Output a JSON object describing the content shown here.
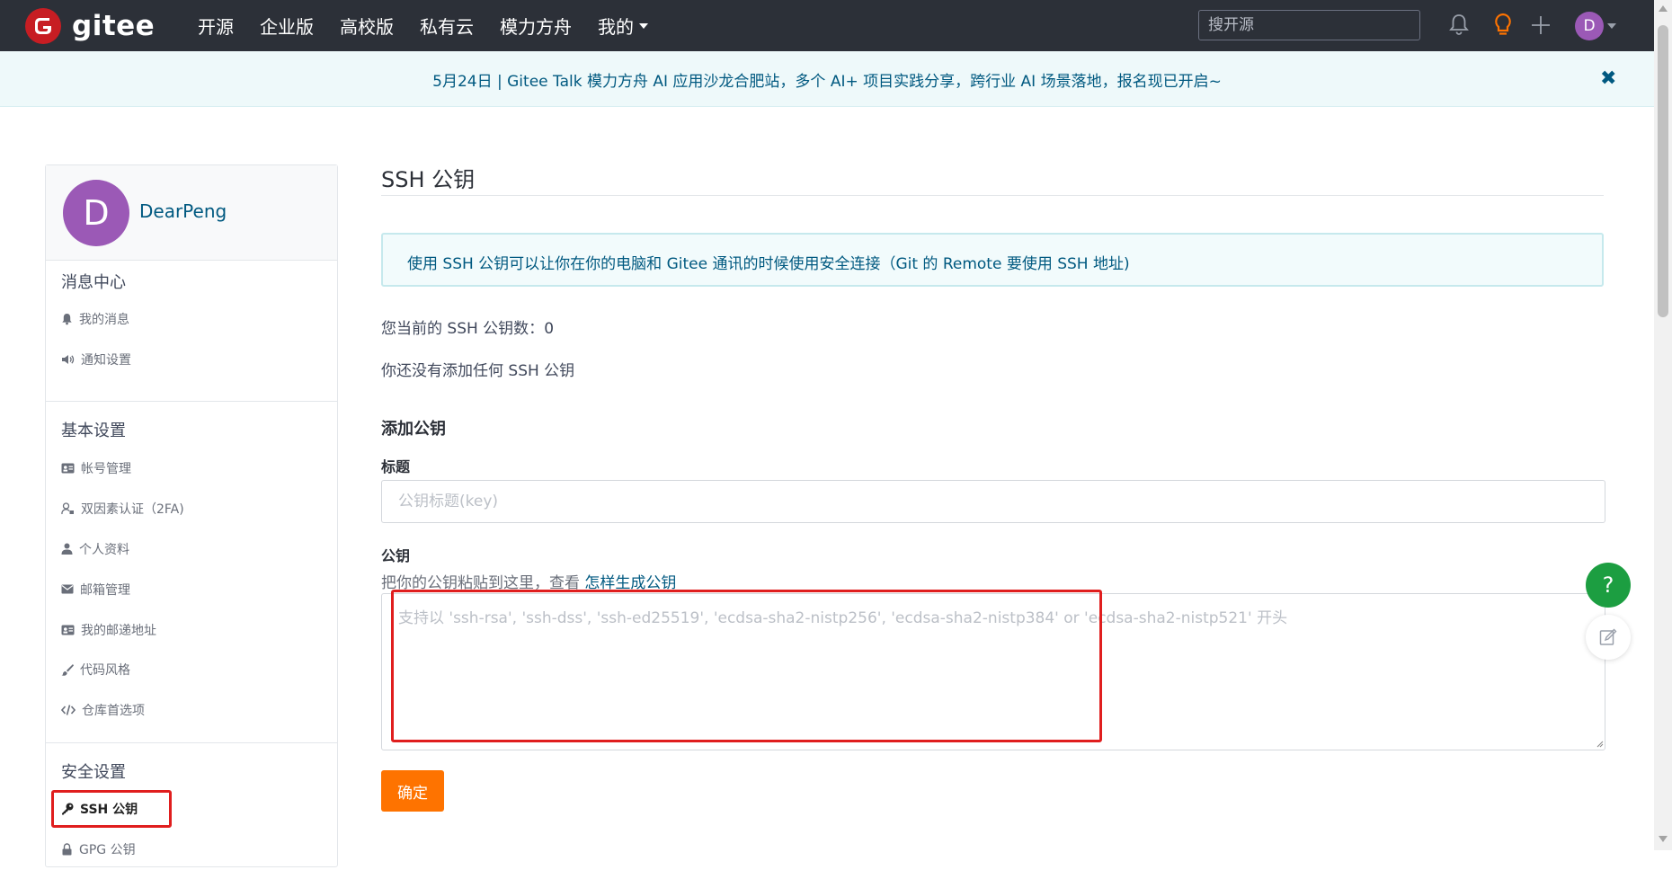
{
  "brand": {
    "logo_text": "gitee",
    "logo_letter": "G"
  },
  "nav": {
    "items": [
      {
        "label": "开源"
      },
      {
        "label": "企业版"
      },
      {
        "label": "高校版"
      },
      {
        "label": "私有云"
      },
      {
        "label": "模力方舟"
      },
      {
        "label": "我的"
      }
    ],
    "search_placeholder": "搜开源",
    "avatar_letter": "D"
  },
  "notice": {
    "text": "5月24日 | Gitee Talk 模力方舟 AI 应用沙龙合肥站，多个 AI+ 项目实践分享，跨行业 AI 场景落地，报名现已开启~",
    "close_glyph": "✖"
  },
  "sidebar": {
    "profile": {
      "avatar_letter": "D",
      "username": "DearPeng"
    },
    "groups": [
      {
        "title": "消息中心",
        "items": [
          {
            "label": "我的消息",
            "icon": "bell-icon"
          },
          {
            "label": "通知设置",
            "icon": "speaker-icon"
          }
        ]
      },
      {
        "title": "基本设置",
        "items": [
          {
            "label": "帐号管理",
            "icon": "id-card-icon"
          },
          {
            "label": "双因素认证（2FA)",
            "icon": "user-lock-icon"
          },
          {
            "label": "个人资料",
            "icon": "person-icon"
          },
          {
            "label": "邮箱管理",
            "icon": "envelope-icon"
          },
          {
            "label": "我的邮递地址",
            "icon": "address-card-icon"
          },
          {
            "label": "代码风格",
            "icon": "brush-icon"
          },
          {
            "label": "仓库首选项",
            "icon": "code-icon"
          }
        ]
      },
      {
        "title": "安全设置",
        "items": [
          {
            "label": "SSH 公钥",
            "icon": "key-icon",
            "active": true
          },
          {
            "label": "GPG 公钥",
            "icon": "lock-icon"
          }
        ]
      }
    ]
  },
  "main": {
    "page_title": "SSH 公钥",
    "info": "使用 SSH 公钥可以让你在你的电脑和 Gitee 通讯的时候使用安全连接（Git 的 Remote 要使用 SSH 地址)",
    "count_label": "您当前的 SSH 公钥数：",
    "count_value": "0",
    "empty_text": "你还没有添加任何 SSH 公钥",
    "add_section_title": "添加公钥",
    "title_label": "标题",
    "title_placeholder": "公钥标题(key)",
    "key_label": "公钥",
    "key_hint": "把你的公钥粘贴到这里，查看",
    "key_hint_link": "怎样生成公钥",
    "key_placeholder": "支持以 'ssh-rsa', 'ssh-dss', 'ssh-ed25519', 'ecdsa-sha2-nistp256', 'ecdsa-sha2-nistp384' or 'ecdsa-sha2-nistp521' 开头",
    "confirm_label": "确定"
  },
  "floating": {
    "help_glyph": "?"
  },
  "colors": {
    "topbar": "#2c3038",
    "brand_red": "#c71d23",
    "accent_orange": "#fe7300",
    "link_blue": "#005980",
    "help_green": "#1c9e41",
    "avatar_purple": "#9b59b6",
    "highlight_red": "#e01e1e"
  }
}
